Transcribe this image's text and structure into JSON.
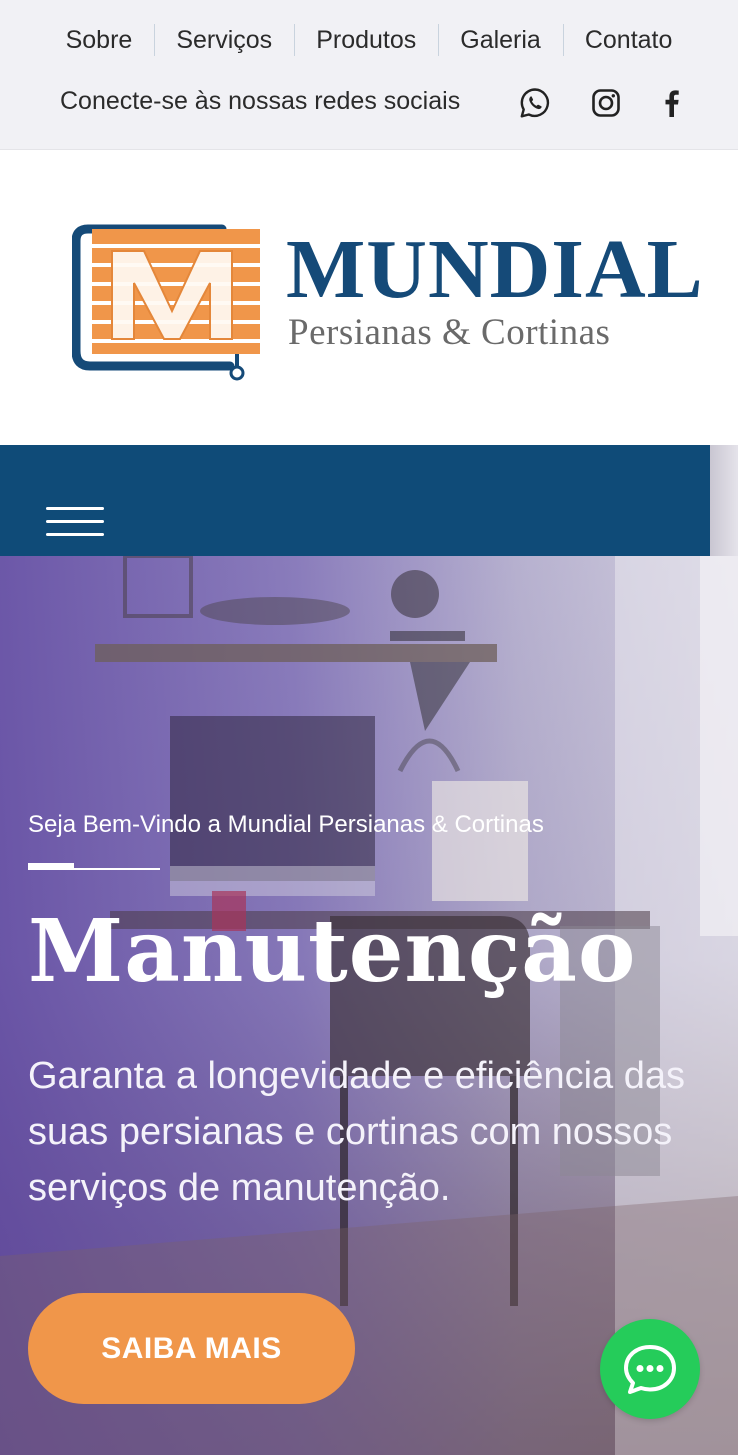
{
  "top_nav": {
    "items": [
      {
        "label": "Sobre"
      },
      {
        "label": "Serviços"
      },
      {
        "label": "Produtos"
      },
      {
        "label": "Galeria"
      },
      {
        "label": "Contato"
      }
    ]
  },
  "social": {
    "label": "Conecte-se às nossas redes sociais",
    "icons": [
      "whatsapp-icon",
      "instagram-icon",
      "facebook-icon"
    ]
  },
  "brand": {
    "name": "MUNDIAL",
    "subtitle": "Persianas & Cortinas",
    "logo_letter": "M"
  },
  "hero": {
    "kicker": "Seja Bem-Vindo a Mundial Persianas & Cortinas",
    "title": "Manutenção",
    "text": "Garanta a longevidade e eficiência das suas persianas e cortinas com nossos serviços de manutenção.",
    "cta_label": "SAIBA MAIS"
  },
  "colors": {
    "topbar_bg": "#f1f1f5",
    "navbar_bg": "#0f4b78",
    "brand_blue": "#154a78",
    "brand_orange": "#f0964a",
    "chat_green": "#25cc5a"
  }
}
